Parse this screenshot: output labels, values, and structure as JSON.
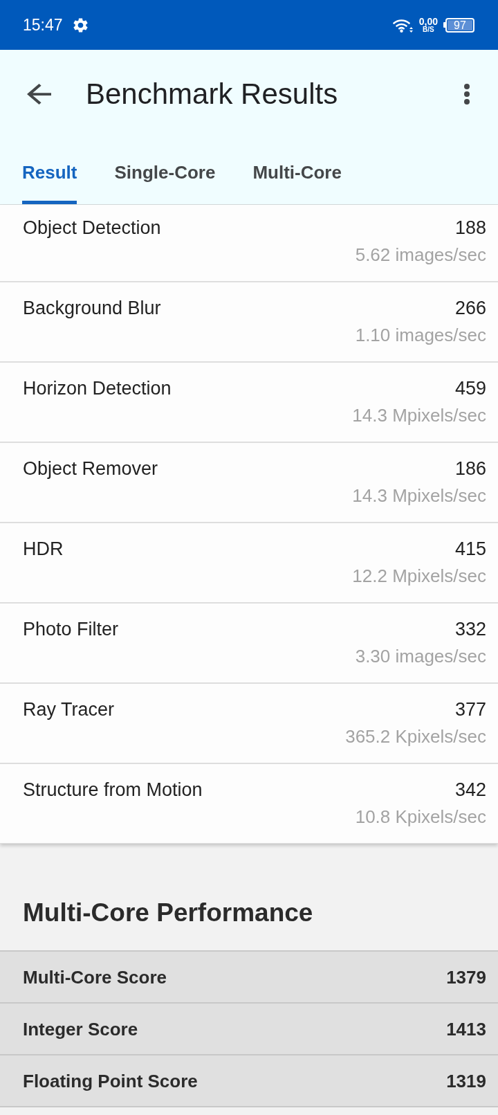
{
  "status_bar": {
    "time": "15:47",
    "network_speed": "0,00",
    "network_speed_unit": "B/S",
    "battery": "97"
  },
  "app_bar": {
    "title": "Benchmark Results"
  },
  "tabs": [
    {
      "label": "Result",
      "selected": true
    },
    {
      "label": "Single-Core",
      "selected": false
    },
    {
      "label": "Multi-Core",
      "selected": false
    }
  ],
  "results": [
    {
      "name": "Object Detection",
      "score": "188",
      "rate": "5.62 images/sec"
    },
    {
      "name": "Background Blur",
      "score": "266",
      "rate": "1.10 images/sec"
    },
    {
      "name": "Horizon Detection",
      "score": "459",
      "rate": "14.3 Mpixels/sec"
    },
    {
      "name": "Object Remover",
      "score": "186",
      "rate": "14.3 Mpixels/sec"
    },
    {
      "name": "HDR",
      "score": "415",
      "rate": "12.2 Mpixels/sec"
    },
    {
      "name": "Photo Filter",
      "score": "332",
      "rate": "3.30 images/sec"
    },
    {
      "name": "Ray Tracer",
      "score": "377",
      "rate": "365.2 Kpixels/sec"
    },
    {
      "name": "Structure from Motion",
      "score": "342",
      "rate": "10.8 Kpixels/sec"
    }
  ],
  "multi_core_performance": {
    "title": "Multi-Core Performance",
    "scores": [
      {
        "label": "Multi-Core Score",
        "value": "1379"
      },
      {
        "label": "Integer Score",
        "value": "1413"
      },
      {
        "label": "Floating Point Score",
        "value": "1319"
      }
    ]
  }
}
